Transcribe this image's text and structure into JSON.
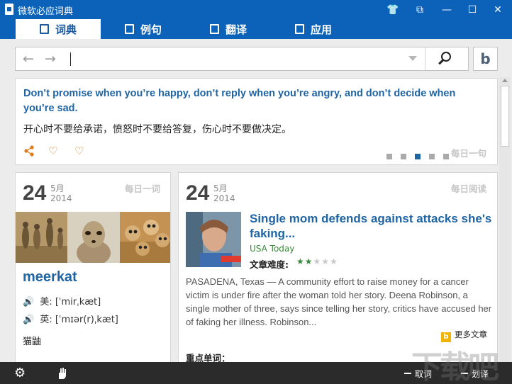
{
  "window": {
    "title": "微软必应词典",
    "buttons": {
      "skin": "👕",
      "mini": "⧉",
      "minimize": "—",
      "maximize": "☐",
      "close": "✕"
    }
  },
  "tabs": [
    {
      "label": "词典",
      "active": true
    },
    {
      "label": "例句",
      "active": false
    },
    {
      "label": "翻译",
      "active": false
    },
    {
      "label": "应用",
      "active": false
    }
  ],
  "search": {
    "back": "←",
    "forward": "→",
    "value": "",
    "placeholder": "",
    "bing_logo": "b"
  },
  "daily_sentence": {
    "english": "Don’t promise when you’re happy, don’t reply when you’re angry, and don’t decide when you’re sad.",
    "chinese": "开心时不要给承诺，愤怒时不要给答复，伤心时不要做决定。",
    "icons": {
      "share": "share-icon",
      "like": "♡",
      "dislike": "♡"
    },
    "pager_total": 5,
    "pager_active": 4,
    "tag": "每日一句"
  },
  "daily_word": {
    "day": "24",
    "month": "5月",
    "year": "2014",
    "tag": "每日一词",
    "word": "meerkat",
    "phonetics": [
      {
        "label": "美:",
        "ipa": "[ˈmirˌkæt]"
      },
      {
        "label": "英:",
        "ipa": "[ˈmɪər(r)ˌkæt]"
      }
    ],
    "meaning": "猫鼬"
  },
  "daily_reading": {
    "day": "24",
    "month": "5月",
    "year": "2014",
    "tag": "每日阅读",
    "title": "Single mom defends against attacks she's faking...",
    "source": "USA Today",
    "difficulty_label": "文章难度:",
    "difficulty": 2,
    "difficulty_max": 5,
    "body": "PASADENA, Texas — A community effort to raise money for a cancer victim is under fire after the woman told her story. Deena Robinson, a single mother of three, says since telling her story, critics have accused her of faking her illness. Robinson...",
    "more_label": "更多文章",
    "key_words_label": "重点单词："
  },
  "bottom_bar": {
    "settings_icon": "gear-icon",
    "app_icon": "hand-icon",
    "capture_label": "取词",
    "translate_label": "划译"
  },
  "watermark": "下载吧"
}
